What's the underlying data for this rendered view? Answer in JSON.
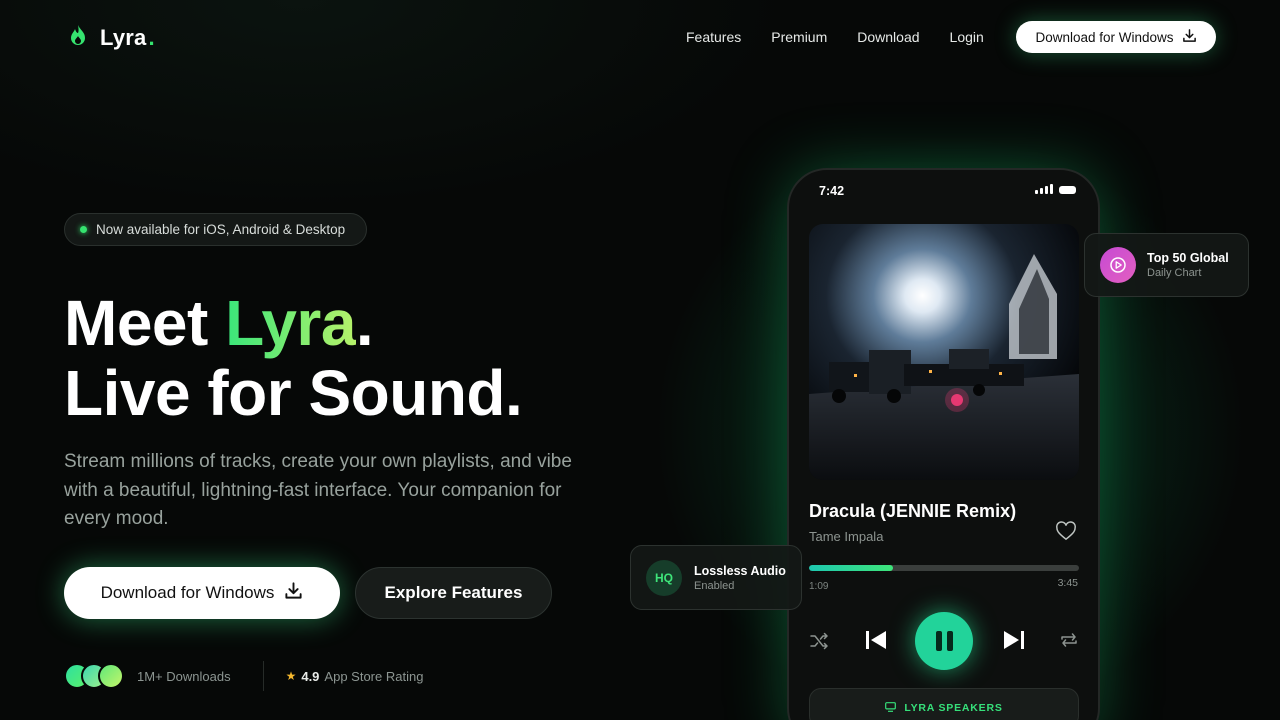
{
  "brand": {
    "name": "Lyra",
    "dot": ".",
    "accent_color": "#35e36f"
  },
  "nav": {
    "links": [
      "Features",
      "Premium",
      "Download",
      "Login"
    ],
    "cta_label": "Download for Windows"
  },
  "hero": {
    "badge": "Now available for iOS, Android & Desktop",
    "headline_line1_prefix": "Meet ",
    "headline_line1_accent": "Lyra",
    "headline_line1_suffix": ".",
    "headline_line2": "Live for Sound.",
    "subtext": "Stream millions of tracks, create your own playlists, and vibe with a beautiful, lightning-fast interface. Your companion for every mood.",
    "primary_cta": "Download for Windows",
    "secondary_cta": "Explore Features",
    "downloads": "1M+ Downloads",
    "rating_value": "4.9",
    "rating_label": "App Store Rating"
  },
  "phone": {
    "time": "7:42",
    "track_title": "Dracula (JENNIE Remix)",
    "artist": "Tame Impala",
    "elapsed": "1:09",
    "total": "3:45",
    "progress": 0.31,
    "speakers_label": "LYRA SPEAKERS"
  },
  "cards": {
    "chart_title": "Top 50 Global",
    "chart_sub": "Daily Chart",
    "hq_badge": "HQ",
    "hq_title": "Lossless Audio",
    "hq_sub": "Enabled"
  },
  "icons": {
    "logo": "flame-icon",
    "download": "download-icon",
    "heart": "heart-icon",
    "shuffle": "shuffle-icon",
    "prev": "skip-previous-icon",
    "play": "pause-icon",
    "next": "skip-next-icon",
    "repeat": "repeat-icon",
    "speakers": "cast-icon",
    "chart": "play-circle-icon"
  }
}
